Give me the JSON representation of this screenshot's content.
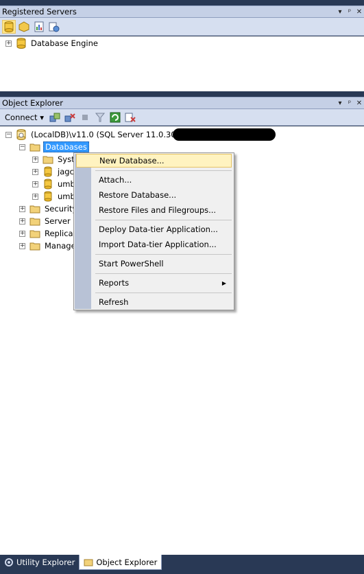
{
  "registered_servers": {
    "title": "Registered Servers",
    "tree": [
      "Database Engine"
    ]
  },
  "object_explorer": {
    "title": "Object Explorer",
    "connect_label": "Connect ▾",
    "server_node": "(LocalDB)\\v11.0 (SQL Server 11.0.3000 -",
    "nodes": {
      "databases": "Databases",
      "system": "Syste",
      "db1": "jagc-",
      "db2": "umb",
      "db3": "umb",
      "security": "Security",
      "server_objects": "Server O",
      "replication": "Replicat",
      "management": "Manage"
    }
  },
  "context_menu": {
    "items": {
      "new_database": "New Database...",
      "attach": "Attach...",
      "restore_database": "Restore Database...",
      "restore_files": "Restore Files and Filegroups...",
      "deploy": "Deploy Data-tier Application...",
      "import": "Import Data-tier Application...",
      "powershell": "Start PowerShell",
      "reports": "Reports",
      "refresh": "Refresh"
    }
  },
  "tabs": {
    "utility": "Utility Explorer",
    "object": "Object Explorer"
  },
  "colors": {
    "chrome": "#293955",
    "title_bar": "#c5d0e6",
    "selection": "#3399ff",
    "menu_highlight": "#fff3c0"
  }
}
